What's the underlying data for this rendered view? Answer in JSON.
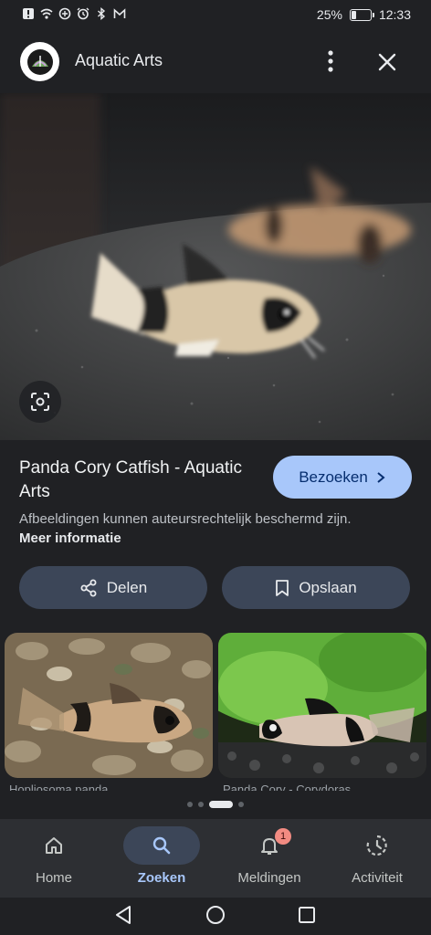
{
  "status_bar": {
    "battery_text": "25%",
    "battery_level": 0.25,
    "time": "12:33",
    "left_icons": [
      "alert-icon",
      "wifi-icon",
      "data-saver-icon",
      "alarm-icon",
      "bluetooth-icon",
      "gmail-icon"
    ]
  },
  "header": {
    "site_name": "Aquatic Arts"
  },
  "result": {
    "title": "Panda Cory Catfish - Aquatic Arts",
    "visit_label": "Bezoeken",
    "notice_text": "Afbeeldingen kunnen auteursrechtelijk beschermd zijn.",
    "notice_link": "Meer informatie"
  },
  "actions": {
    "share_label": "Delen",
    "save_label": "Opslaan"
  },
  "related": [
    {
      "caption": "Hopliosoma panda"
    },
    {
      "caption": "Panda Cory - Corydoras"
    }
  ],
  "carousel": {
    "active_index": 2,
    "count": 4
  },
  "bottom_nav": [
    {
      "label": "Home",
      "icon": "home-icon",
      "active": false
    },
    {
      "label": "Zoeken",
      "icon": "search-icon",
      "active": true
    },
    {
      "label": "Meldingen",
      "icon": "bell-icon",
      "active": false,
      "badge": "1"
    },
    {
      "label": "Activiteit",
      "icon": "activity-icon",
      "active": false
    }
  ],
  "colors": {
    "background": "#202124",
    "accent": "#a8c7fa",
    "button_bg": "#3c4658",
    "badge": "#f28b82"
  }
}
